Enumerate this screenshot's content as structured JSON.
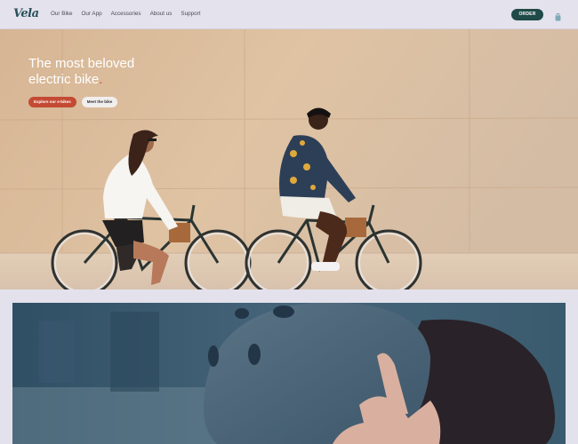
{
  "brand": {
    "name": "Vela"
  },
  "nav": {
    "links": [
      "Our Bike",
      "Our App",
      "Accessories",
      "About us",
      "Support"
    ],
    "order_label": "ORDER"
  },
  "hero": {
    "title_line1": "The most beloved",
    "title_line2": "electric bike",
    "title_dot": ".",
    "primary_button": "Explore our e-bikes",
    "secondary_button": "Meet the bike"
  },
  "colors": {
    "nav_bg": "#e4e2ec",
    "accent_red": "#c44a34",
    "brand_teal": "#1f4a47"
  },
  "icons": {
    "cart": "shopping-bag-icon"
  }
}
